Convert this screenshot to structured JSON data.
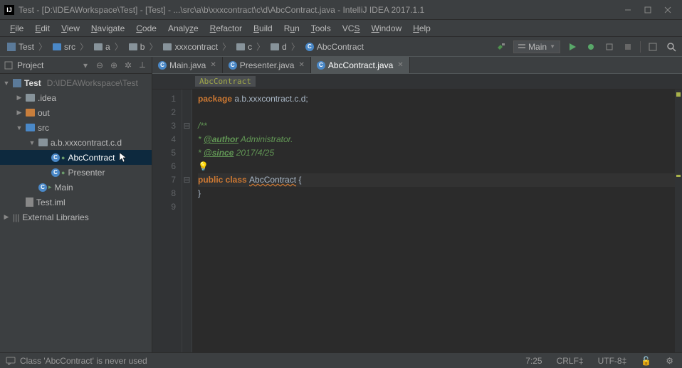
{
  "titlebar": {
    "title": "Test - [D:\\IDEAWorkspace\\Test] - [Test] - ...\\src\\a\\b\\xxxcontract\\c\\d\\AbcContract.java - IntelliJ IDEA 2017.1.1"
  },
  "menu": [
    "File",
    "Edit",
    "View",
    "Navigate",
    "Code",
    "Analyze",
    "Refactor",
    "Build",
    "Run",
    "Tools",
    "VCS",
    "Window",
    "Help"
  ],
  "breadcrumb": [
    {
      "icon": "proj",
      "label": "Test"
    },
    {
      "icon": "folder-src",
      "label": "src"
    },
    {
      "icon": "folder-gray",
      "label": "a"
    },
    {
      "icon": "folder-gray",
      "label": "b"
    },
    {
      "icon": "folder-gray",
      "label": "xxxcontract"
    },
    {
      "icon": "folder-gray",
      "label": "c"
    },
    {
      "icon": "folder-gray",
      "label": "d"
    },
    {
      "icon": "class",
      "label": "AbcContract"
    }
  ],
  "run_config": "Main",
  "project_panel": {
    "title": "Project",
    "root": {
      "label": "Test",
      "path": "D:\\IDEAWorkspace\\Test"
    },
    "idea": ".idea",
    "out": "out",
    "src": "src",
    "pkg": "a.b.xxxcontract.c.d",
    "file_abc": "AbcContract",
    "file_presenter": "Presenter",
    "file_main": "Main",
    "iml": "Test.iml",
    "ext": "External Libraries"
  },
  "tabs": [
    {
      "label": "Main.java",
      "active": false
    },
    {
      "label": "Presenter.java",
      "active": false
    },
    {
      "label": "AbcContract.java",
      "active": true
    }
  ],
  "editor_breadcrumb": "AbcContract",
  "code": {
    "l1_kw": "package",
    "l1_pkg": "a.b.xxxcontract.c.d",
    "l3": "/**",
    "l4_tag": "@author",
    "l4_rest": " Administrator.",
    "l5_tag": "@since",
    "l5_rest": " 2017/4/25",
    "l7_kw": "public class ",
    "l7_cls": "AbcContract",
    "l7_brace": " {",
    "l8": "}"
  },
  "status": {
    "msg": "Class 'AbcContract' is never used",
    "pos": "7:25",
    "eol": "CRLF‡",
    "enc": "UTF-8‡"
  }
}
